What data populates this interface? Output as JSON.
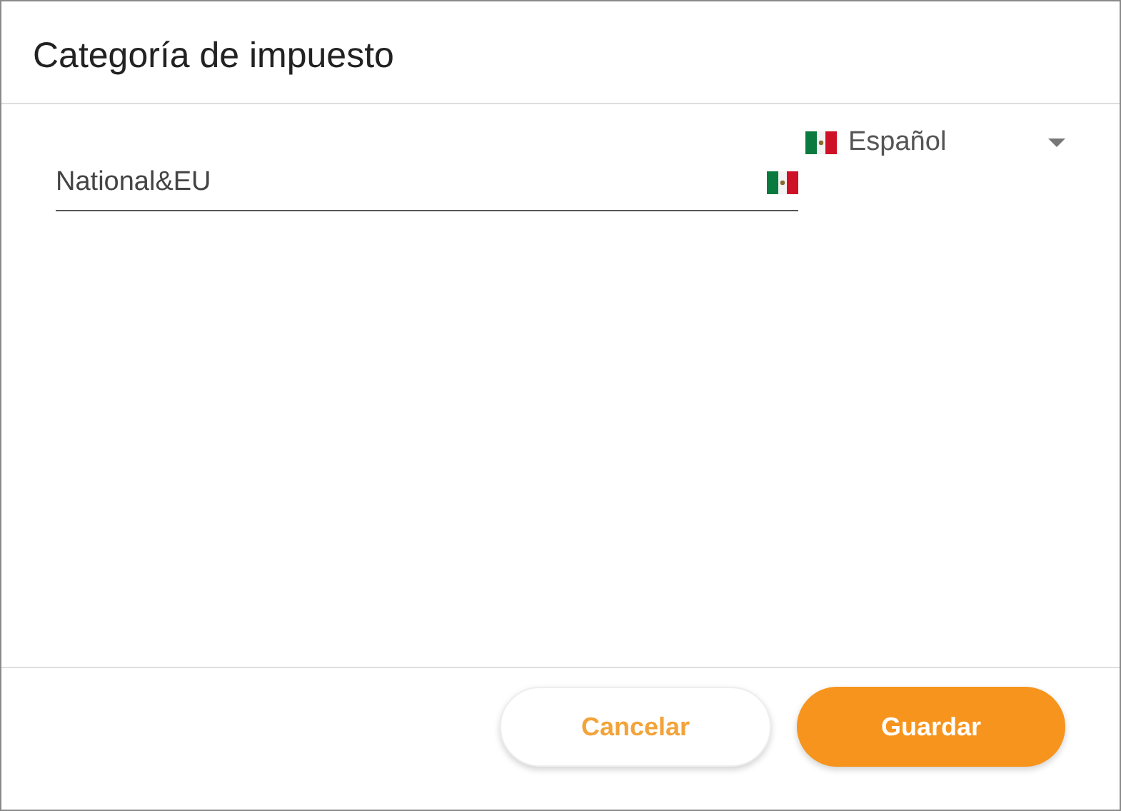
{
  "dialog": {
    "title": "Categoría de impuesto"
  },
  "language_select": {
    "value": "Español"
  },
  "name_field": {
    "value": "National&EU"
  },
  "buttons": [
    {
      "label": "Cancelar",
      "kind": "secondary"
    },
    {
      "label": "Guardar",
      "kind": "primary"
    }
  ]
}
